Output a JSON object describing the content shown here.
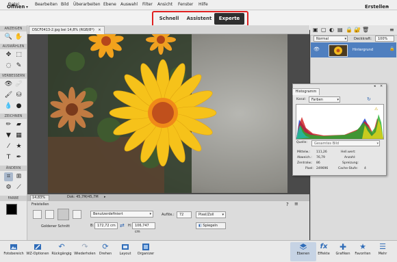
{
  "menubar": {
    "items": [
      "Datei",
      "Bearbeiten",
      "Bild",
      "Überarbeiten",
      "Ebene",
      "Auswahl",
      "Filter",
      "Ansicht",
      "Fenster",
      "Hilfe"
    ]
  },
  "modebar": {
    "open_label": "Öffnen",
    "create_label": "Erstellen",
    "tabs": [
      "Schnell",
      "Assistent",
      "Experte"
    ],
    "active_tab": "Experte"
  },
  "toolbar": {
    "sections": [
      "ANZEIGEN",
      "AUSWÄHLEN",
      "VERBESSERN",
      "ZEICHNEN",
      "ÄNDERN",
      "FARBE"
    ]
  },
  "document": {
    "tab_label": "DSCF0413-2.jpg bei 14,8% (RGB/8*)",
    "zoom": "14,83%",
    "doc_size": "Dok: 45,7M/45,7M"
  },
  "tool_options": {
    "tool_name": "Freistellen",
    "preset_label": "Benutzerdefiniert",
    "width_label": "B:",
    "width_value": "172,72 cm",
    "height_label": "H:",
    "height_value": "106,747 cm",
    "resolution_label": "Auflös.:",
    "resolution_value": "72",
    "unit_value": "Pixel/Zoll",
    "mirror_button": "Spiegeln",
    "golden_ratio_label": "Goldener Schnitt"
  },
  "layers": {
    "blend_mode": "Normal",
    "opacity_label": "Deckkraft:",
    "opacity_value": "100%",
    "layer_name": "Hintergrund"
  },
  "histogram": {
    "title": "Histogramm",
    "channel_label": "Kanal:",
    "channel_value": "Farben",
    "source_label": "Quelle:",
    "source_value": "Gesamtes Bild",
    "stats_left": [
      {
        "label": "Mittelw.:",
        "value": "111,26"
      },
      {
        "label": "Abweich.:",
        "value": "76,79"
      },
      {
        "label": "Zentralw.:",
        "value": "86"
      },
      {
        "label": "Pixel:",
        "value": "249696"
      }
    ],
    "stats_right": [
      {
        "label": "Hell.wert:",
        "value": ""
      },
      {
        "label": "Anzahl:",
        "value": ""
      },
      {
        "label": "Spreizung:",
        "value": ""
      },
      {
        "label": "Cache-Stufe:",
        "value": "4"
      }
    ]
  },
  "bottombar": {
    "left_buttons": [
      "Fotobereich",
      "WZ-Optionen",
      "Rückgängig",
      "Wiederholen",
      "Drehen",
      "Layout",
      "Organizer"
    ],
    "right_buttons": [
      "Ebenen",
      "Effekte",
      "Grafiken",
      "Favoriten",
      "Mehr"
    ]
  }
}
